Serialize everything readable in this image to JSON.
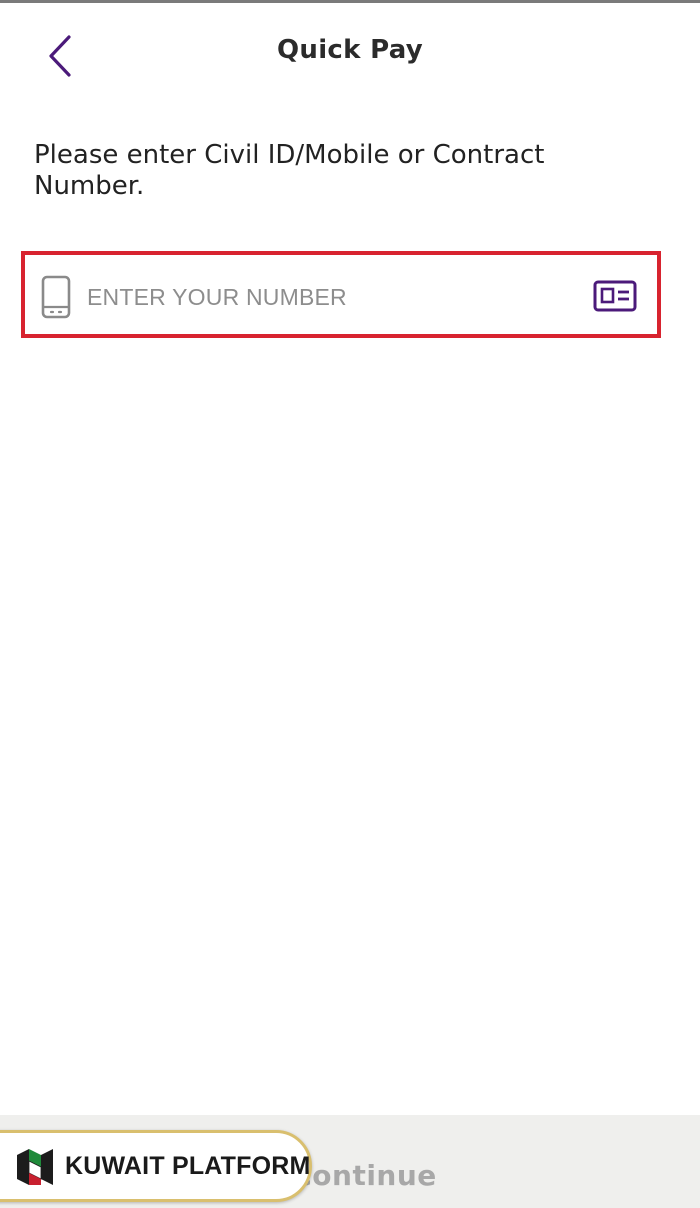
{
  "header": {
    "title": "Quick Pay",
    "back_icon": "chevron-left-icon"
  },
  "instruction": {
    "text": "Please enter Civil ID/Mobile or Contract Number."
  },
  "number_input": {
    "value": "",
    "placeholder": "ENTER YOUR NUMBER",
    "leading_icon": "mobile-phone-icon",
    "trailing_icon": "id-card-icon",
    "highlight_color": "#d8232f"
  },
  "footer": {
    "continue_label": "Continue"
  },
  "watermark": {
    "brand_name": "KUWAIT PLATFORM"
  },
  "colors": {
    "accent": "#4b1a7a",
    "icon_gray": "#8a8a8a",
    "disabled_text": "#a8a8a8"
  }
}
